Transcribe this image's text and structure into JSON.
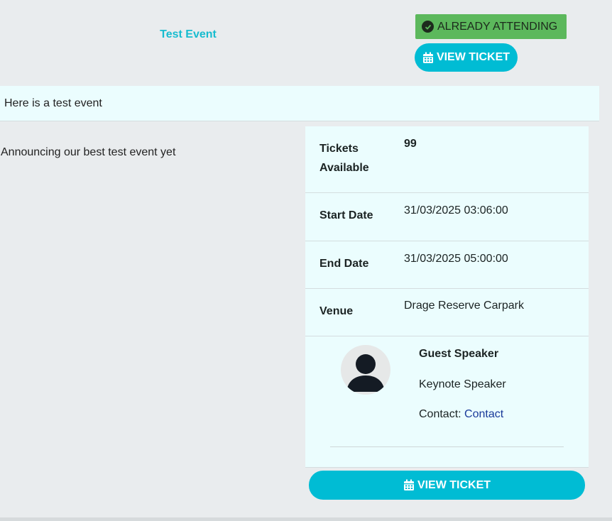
{
  "event": {
    "title": "Test Event",
    "status_badge": "ALREADY ATTENDING",
    "view_ticket_label": "VIEW TICKET",
    "summary": "Here is a test event",
    "description": "Announcing our best test event yet"
  },
  "details": {
    "tickets_label": "Tickets Available",
    "tickets_value": "99",
    "start_label": "Start Date",
    "start_value": "31/03/2025 03:06:00",
    "end_label": "End Date",
    "end_value": "31/03/2025 05:00:00",
    "venue_label": "Venue",
    "venue_value": "Drage Reserve Carpark"
  },
  "speaker": {
    "name": "Guest Speaker",
    "role": "Keynote Speaker",
    "contact_prefix": "Contact: ",
    "contact_link": "Contact"
  },
  "colors": {
    "accent": "#00bcd4",
    "badge_green": "#5cb85c",
    "panel_bg": "#ebfdfe",
    "page_bg": "#e9ecee"
  },
  "icons": [
    "check-circle-icon",
    "calendar-icon",
    "user-avatar-icon"
  ]
}
